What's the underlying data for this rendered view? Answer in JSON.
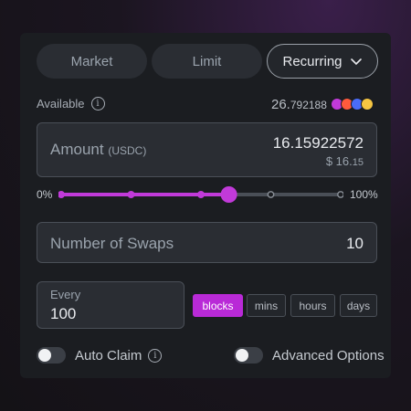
{
  "tabs": [
    {
      "label": "Market"
    },
    {
      "label": "Limit"
    },
    {
      "label": "Recurring"
    }
  ],
  "available": {
    "label": "Available",
    "value_int": "26.",
    "value_dec": "792188",
    "token_colors": [
      "#c13ad9",
      "#ff5a3c",
      "#4a6cf7",
      "#f5c542"
    ]
  },
  "amount": {
    "label": "Amount",
    "unit": "(USDC)",
    "value": "16.15922572",
    "usd_int": "$ 16.",
    "usd_dec": "15"
  },
  "slider": {
    "min_label": "0%",
    "max_label": "100%",
    "value_fraction": 0.6,
    "stops": [
      0,
      0.25,
      0.5,
      0.75,
      1
    ],
    "accent": "#c13ad9",
    "track": "#4a4f57"
  },
  "swaps": {
    "label": "Number of Swaps",
    "value": "10"
  },
  "every": {
    "label": "Every",
    "value": "100"
  },
  "units": [
    {
      "label": "blocks",
      "active": true
    },
    {
      "label": "mins",
      "active": false
    },
    {
      "label": "hours",
      "active": false
    },
    {
      "label": "days",
      "active": false
    }
  ],
  "toggles": {
    "auto_claim": {
      "label": "Auto Claim",
      "on": false
    },
    "advanced": {
      "label": "Advanced Options",
      "on": false
    }
  },
  "colors": {
    "accent": "#b92ad7",
    "panel": "#1b1d21",
    "field": "#2a2d33"
  }
}
